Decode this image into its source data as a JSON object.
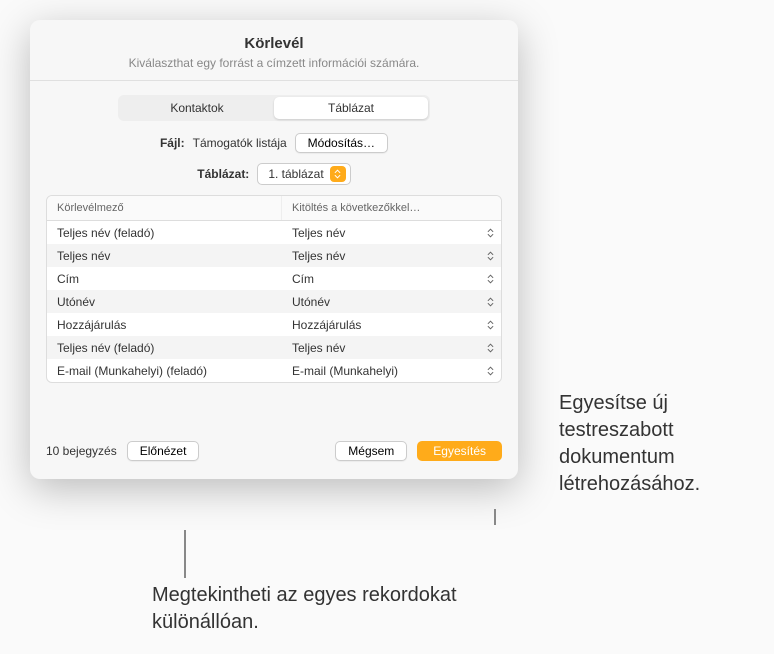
{
  "dialog": {
    "title": "Körlevél",
    "subtitle": "Kiválaszthat egy forrást a címzett információi számára.",
    "tabs": {
      "contacts": "Kontaktok",
      "spreadsheet": "Táblázat"
    },
    "file_label": "Fájl:",
    "file_value": "Támogatók listája",
    "file_change": "Módosítás…",
    "table_label": "Táblázat:",
    "table_value": "1. táblázat",
    "columns": {
      "field": "Körlevélmező",
      "fill": "Kitöltés a következőkkel…"
    },
    "rows": [
      {
        "field": "Teljes név (feladó)",
        "fill": "Teljes név"
      },
      {
        "field": "Teljes név",
        "fill": "Teljes név"
      },
      {
        "field": "Cím",
        "fill": "Cím"
      },
      {
        "field": "Utónév",
        "fill": "Utónév"
      },
      {
        "field": "Hozzájárulás",
        "fill": "Hozzájárulás"
      },
      {
        "field": "Teljes név (feladó)",
        "fill": "Teljes név"
      },
      {
        "field": "E-mail (Munkahelyi) (feladó)",
        "fill": "E-mail (Munkahelyi)"
      }
    ],
    "entries_count": "10 bejegyzés",
    "preview": "Előnézet",
    "cancel": "Mégsem",
    "merge": "Egyesítés"
  },
  "callouts": {
    "right": "Egyesítse új testreszabott dokumentum létrehozásához.",
    "bottom": "Megtekintheti az egyes rekordokat különállóan."
  }
}
